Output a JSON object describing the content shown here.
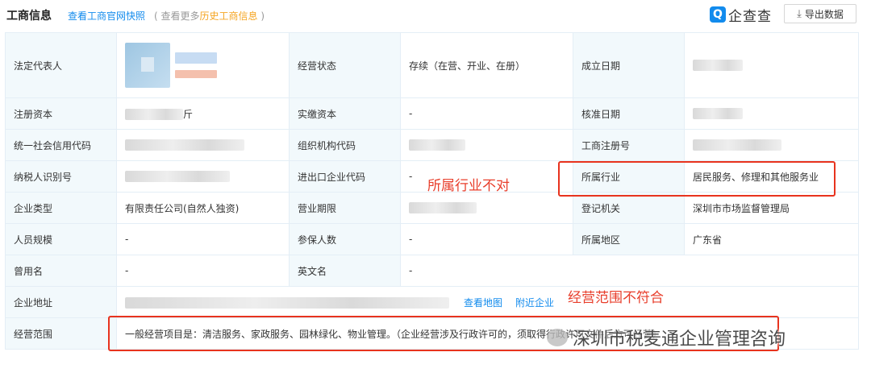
{
  "header": {
    "title": "工商信息",
    "snapshot_link": "查看工商官网快照",
    "hist_prefix": "( 查看更多",
    "hist_link": "历史工商信息",
    "hist_suffix": " )",
    "logo_badge": "Q",
    "logo_text": "企查查",
    "export_icon": "download-icon",
    "export_label": "导出数据"
  },
  "rows": {
    "r0": {
      "l1": "法定代表人",
      "l2": "经营状态",
      "v2": "存续（在营、开业、在册）",
      "l3": "成立日期"
    },
    "r1": {
      "l1": "注册资本",
      "v1_tail": "斤",
      "l2": "实缴资本",
      "v2": "-",
      "l3": "核准日期"
    },
    "r2": {
      "l1": "统一社会信用代码",
      "l2": "组织机构代码",
      "l3": "工商注册号"
    },
    "r3": {
      "l1": "纳税人识别号",
      "l2": "进出口企业代码",
      "v2": "-",
      "l3": "所属行业",
      "v3": "居民服务、修理和其他服务业"
    },
    "r4": {
      "l1": "企业类型",
      "v1": "有限责任公司(自然人独资)",
      "l2": "营业期限",
      "l3": "登记机关",
      "v3": "深圳市市场监督管理局"
    },
    "r5": {
      "l1": "人员规模",
      "v1": "-",
      "l2": "参保人数",
      "v2": "-",
      "l3": "所属地区",
      "v3": "广东省"
    },
    "r6": {
      "l1": "曾用名",
      "v1": "-",
      "l2": "英文名",
      "v2": "-"
    },
    "r7": {
      "l1": "企业地址",
      "map_link": "查看地图",
      "nearby_link": "附近企业"
    },
    "r8": {
      "l1": "经营范围",
      "v1": "一般经营项目是：清洁服务、家政服务、园林绿化、物业管理。（企业经营涉及行政许可的，须取得行政许可文件后方可经营）"
    }
  },
  "annotations": {
    "industry_wrong": "所属行业不对",
    "scope_mismatch": "经营范围不符合"
  },
  "watermark": "深圳市税麦通企业管理咨询",
  "colors": {
    "link": "#128bed",
    "highlight": "#f5a623",
    "annotation": "#e8331e",
    "label_bg": "#f2f9fc"
  }
}
